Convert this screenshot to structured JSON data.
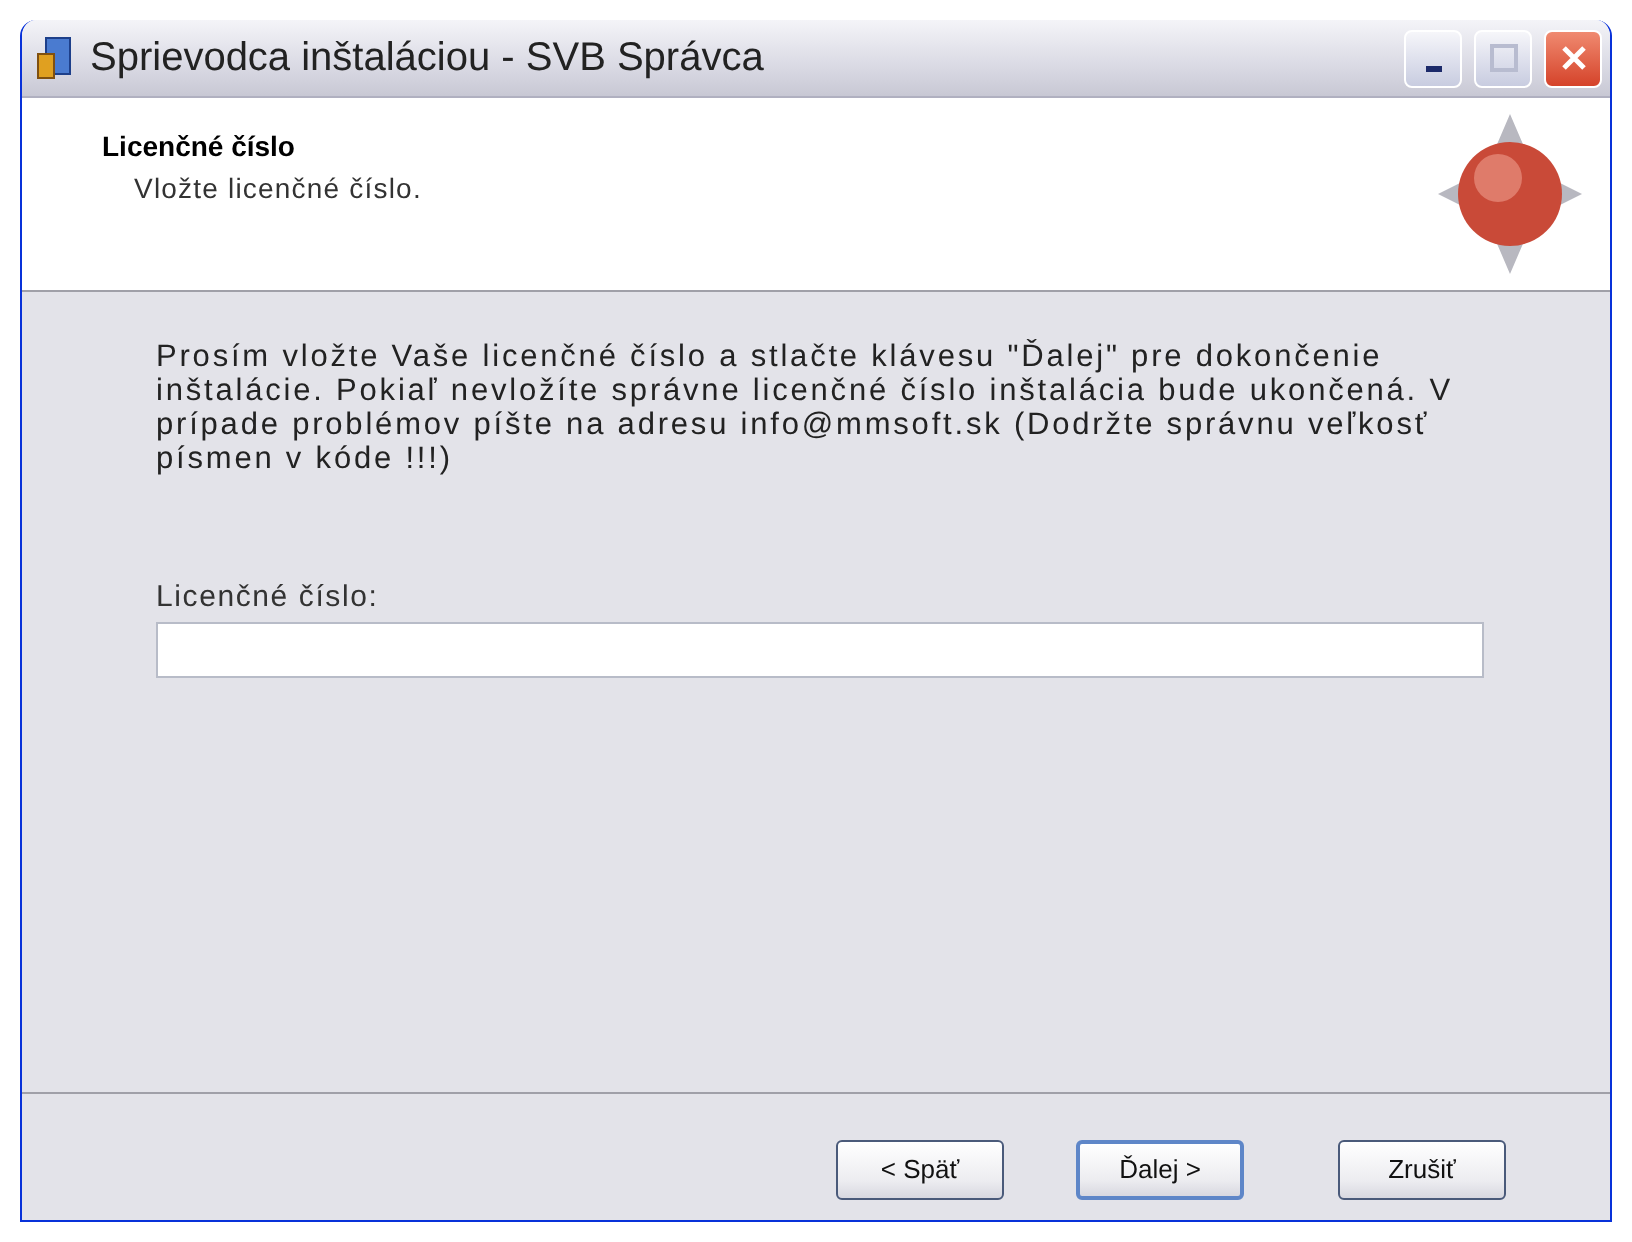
{
  "window": {
    "title": "Sprievodca inštaláciou - SVB Správca"
  },
  "header": {
    "title": "Licenčné číslo",
    "subtitle": "Vložte licenčné číslo."
  },
  "body": {
    "instructions": "Prosím vložte Vaše licenčné číslo a stlačte klávesu \"Ďalej\" pre dokončenie inštalácie. Pokiaľ nevložíte správne licenčné číslo inštalácia bude ukončená. V prípade problémov píšte na adresu info@mmsoft.sk (Dodržte správnu veľkosť písmen v kóde !!!)",
    "field": {
      "label": "Licenčné číslo:"
    }
  },
  "buttons": [
    {
      "label": "< Späť",
      "default": false
    },
    {
      "label": "Ďalej >",
      "default": true
    },
    {
      "label": "Zrušiť",
      "default": false
    }
  ]
}
